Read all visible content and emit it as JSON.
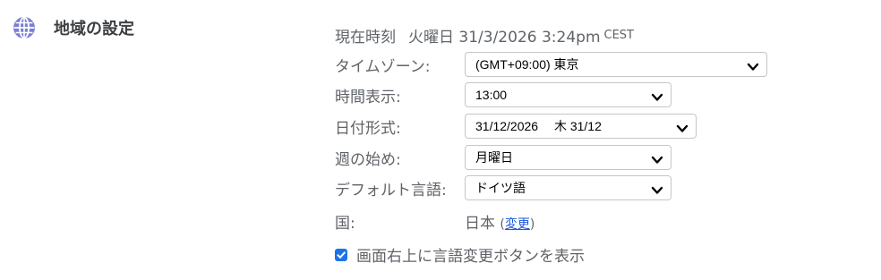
{
  "section": {
    "title": "地域の設定",
    "icon": "globe-icon"
  },
  "current_time": {
    "label": "現在時刻",
    "value": "火曜日 31/3/2026 3:24pm",
    "tz": "CEST"
  },
  "timezone": {
    "label": "タイムゾーン:",
    "selected": "(GMT+09:00) 東京"
  },
  "time_format": {
    "label": "時間表示:",
    "selected": "13:00"
  },
  "date_format": {
    "label": "日付形式:",
    "selected": "31/12/2026　 木 31/12"
  },
  "week_start": {
    "label": "週の始め:",
    "selected": "月曜日"
  },
  "default_language": {
    "label": "デフォルト言語:",
    "selected": "ドイツ語"
  },
  "country": {
    "label": "国:",
    "value": "日本",
    "open_paren": "(",
    "link": "変更",
    "close_paren": ")"
  },
  "show_language_switch": {
    "label": "画面右上に言語変更ボタンを表示",
    "checked": true
  },
  "colors": {
    "accent": "#1a73e8",
    "link": "#1a56db",
    "icon": "#7b7fd4"
  }
}
